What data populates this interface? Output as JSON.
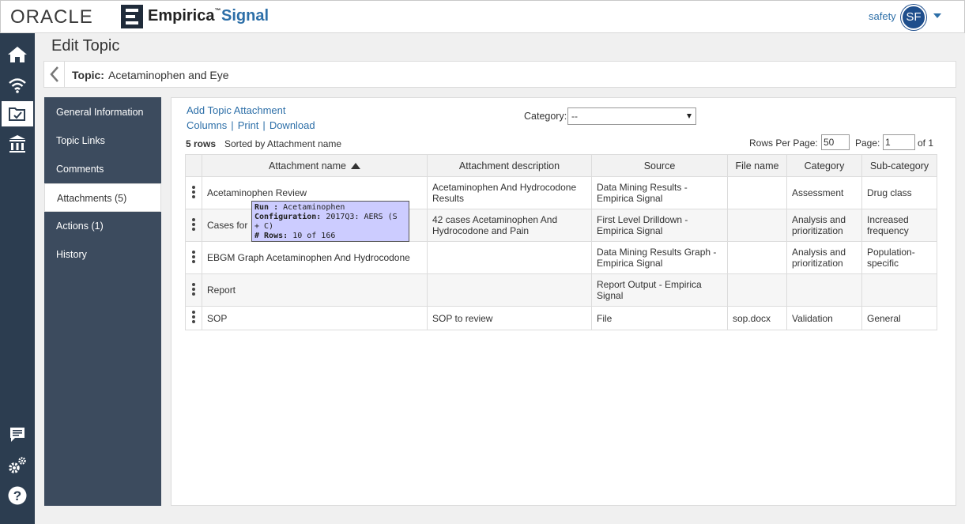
{
  "brand": {
    "oracle": "ORACLE",
    "product": "Empirica",
    "tm": "™",
    "signal": "Signal"
  },
  "user": {
    "name": "safety",
    "initials": "SF"
  },
  "nav_icons": [
    "home-icon",
    "signal-icon",
    "topics-icon",
    "reports-icon",
    "messages-icon",
    "settings-icon",
    "help-icon"
  ],
  "page": {
    "title": "Edit Topic",
    "topic_label": "Topic:",
    "topic_value": "Acetaminophen and Eye"
  },
  "sidemenu": {
    "items": [
      {
        "label": "General Information"
      },
      {
        "label": "Topic Links"
      },
      {
        "label": "Comments"
      },
      {
        "label": "Attachments (5)"
      },
      {
        "label": "Actions (1)"
      },
      {
        "label": "History"
      }
    ]
  },
  "toolbar": {
    "add_attachment": "Add Topic Attachment",
    "columns": "Columns",
    "print": "Print",
    "download": "Download",
    "separator": "|",
    "category_label": "Category:",
    "category_value": "--"
  },
  "summary": {
    "rows": "5 rows",
    "sorted_by": "Sorted by Attachment name",
    "rows_per_page_label": "Rows Per Page:",
    "rows_per_page": "50",
    "page_label": "Page:",
    "page": "1",
    "of_pages": "of 1"
  },
  "table": {
    "headers": [
      "Attachment name",
      "Attachment description",
      "Source",
      "File name",
      "Category",
      "Sub-category"
    ],
    "rows": [
      {
        "name": "Acetaminophen Review",
        "description": "Acetaminophen And Hydrocodone Results",
        "source": "Data Mining Results - Empirica Signal",
        "file": "",
        "category": "Assessment",
        "subcategory": "Drug class"
      },
      {
        "name": "Cases for",
        "description": "42 cases Acetaminophen And Hydrocodone and Pain",
        "source": "First Level Drilldown - Empirica Signal",
        "file": "",
        "category": "Analysis and prioritization",
        "subcategory": "Increased frequency"
      },
      {
        "name": "EBGM Graph Acetaminophen And Hydrocodone",
        "description": "",
        "source": "Data Mining Results Graph - Empirica Signal",
        "file": "",
        "category": "Analysis and prioritization",
        "subcategory": "Population-specific"
      },
      {
        "name": "Report",
        "description": "",
        "source": "Report Output - Empirica Signal",
        "file": "",
        "category": "",
        "subcategory": ""
      },
      {
        "name": "SOP",
        "description": "SOP to review",
        "source": "File",
        "file": "sop.docx",
        "category": "Validation",
        "subcategory": "General"
      }
    ]
  },
  "tooltip": {
    "run_label": "Run :",
    "run_value": "Acetaminophen",
    "config_label": "Configuration:",
    "config_value": "2017Q3: AERS (S + C)",
    "rows_label": "# Rows:",
    "rows_value": "10 of 166"
  }
}
